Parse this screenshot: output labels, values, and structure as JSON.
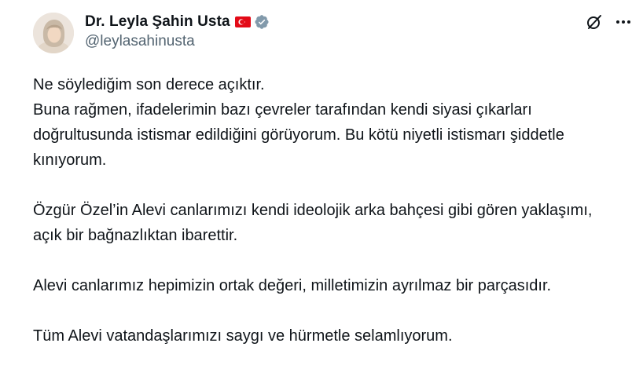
{
  "author": {
    "display_name": "Dr. Leyla Şahin Usta",
    "handle": "@leylasahinusta"
  },
  "icons": {
    "flag": "turkey-flag-icon",
    "verified": "verified-badge-icon",
    "grok": "grok-icon",
    "more": "more-icon"
  },
  "colors": {
    "verified_badge": "#829aab",
    "flag_red": "#e30a17",
    "secondary_text": "#536471"
  },
  "post": {
    "paragraphs": [
      "Ne söylediğim son derece açıktır.\nBuna rağmen, ifadelerimin bazı çevreler tarafından kendi siyasi çıkarları doğrultusunda istismar edildiğini  görüyorum. Bu kötü niyetli istismarı şiddetle kınıyorum.",
      "Özgür Özel’in Alevi canlarımızı kendi ideolojik arka bahçesi gibi gören yaklaşımı, açık bir bağnazlıktan ibarettir.",
      "Alevi canlarımız hepimizin ortak değeri, milletimizin ayrılmaz bir parçasıdır.",
      "Tüm Alevi vatandaşlarımızı saygı ve hürmetle selamlıyorum."
    ]
  }
}
